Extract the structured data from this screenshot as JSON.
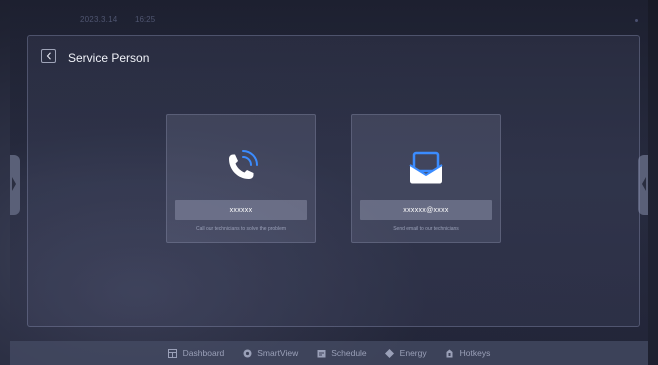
{
  "statusbar": {
    "date": "2023.3.14",
    "time": "16:25"
  },
  "page": {
    "title": "Service Person",
    "back_icon": "chevron-left-icon"
  },
  "cards": [
    {
      "icon": "phone-icon",
      "value": "xxxxxx",
      "description": "Call our technicians to solve the problem"
    },
    {
      "icon": "email-icon",
      "value": "xxxxxx@xxxx",
      "description": "Send email to our technicians"
    }
  ],
  "taskbar": {
    "items": [
      {
        "label": "Dashboard",
        "icon": "dashboard-icon"
      },
      {
        "label": "SmartView",
        "icon": "smartview-icon"
      },
      {
        "label": "Schedule",
        "icon": "schedule-icon"
      },
      {
        "label": "Energy",
        "icon": "energy-icon"
      },
      {
        "label": "Hotkeys",
        "icon": "hotkeys-icon"
      }
    ]
  },
  "colors": {
    "accent_blue": "#3b8cff",
    "panel_border": "#969bbe",
    "text_light": "#f0f2f8",
    "text_muted": "#9aa0b8"
  }
}
